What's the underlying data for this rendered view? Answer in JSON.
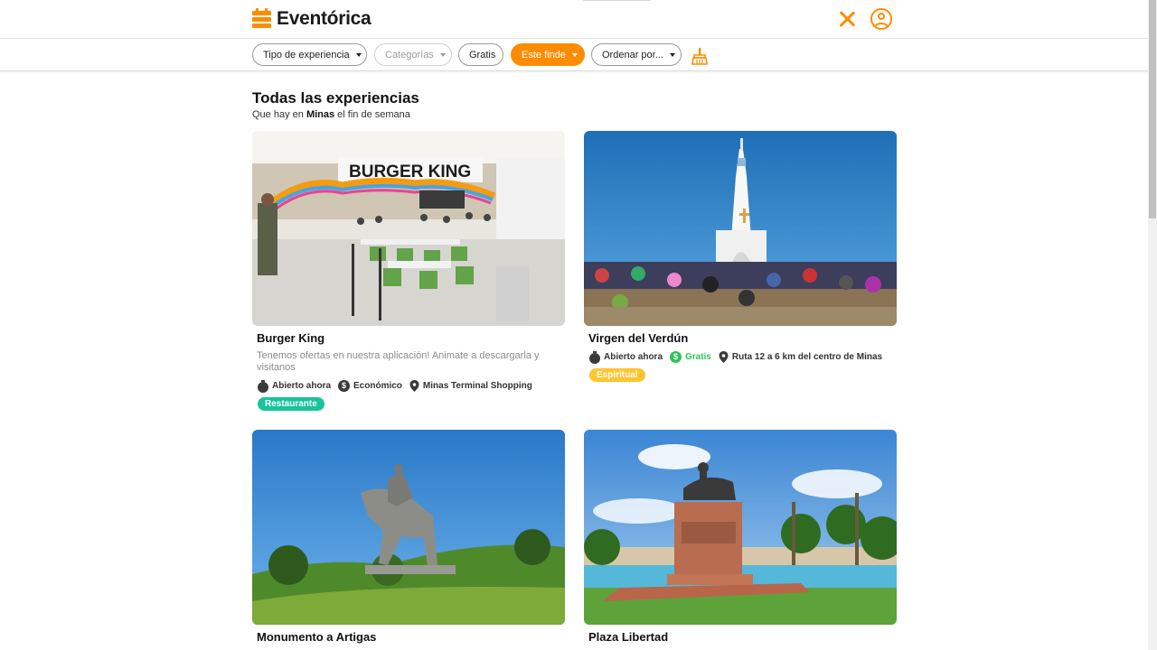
{
  "app": {
    "name": "Eventórica"
  },
  "filters": {
    "tipo_label": "Tipo de experiencia",
    "categorias_label": "Categorías",
    "gratis_label": "Gratis",
    "finde_label": "Este finde",
    "ordenar_label": "Ordenar por..."
  },
  "main": {
    "title": "Todas las experiencias",
    "subtitle_prefix": "Que hay en ",
    "subtitle_city": "Minas",
    "subtitle_suffix": " el fin de semana"
  },
  "cards": [
    {
      "title": "Burger King",
      "description": "Tenemos ofertas en nuestra aplicación! Animate a descargarla y visitanos",
      "status": "Abierto ahora",
      "price": "Económico",
      "location": "Minas Terminal Shopping",
      "tag": "Restaurante",
      "tag_color": "#17c49b",
      "image": "burger-king-food-court-photo"
    },
    {
      "title": "Virgen del Verdún",
      "status": "Abierto ahora",
      "price": "Gratis",
      "location": "Ruta 12 a 6 km del centro de Minas",
      "tag": "Espiritual",
      "tag_color": "#ffc42e",
      "image": "virgen-del-verdun-monument-photo"
    },
    {
      "title": "Monumento a Artigas",
      "image": "equestrian-statue-photo"
    },
    {
      "title": "Plaza Libertad",
      "image": "plaza-statue-fountain-photo"
    }
  ],
  "colors": {
    "accent": "#ff8c00",
    "free_green": "#2ec45a",
    "tag_teal": "#17c49b",
    "tag_yellow": "#ffc42e"
  }
}
